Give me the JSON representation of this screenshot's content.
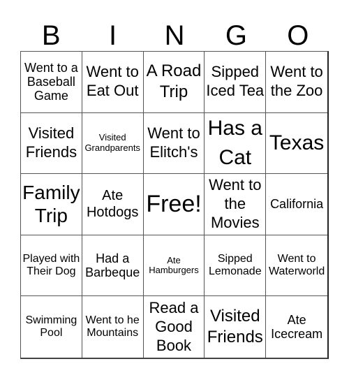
{
  "header": [
    "B",
    "I",
    "N",
    "G",
    "O"
  ],
  "cells": [
    "Went to a Baseball Game",
    "Went to Eat Out",
    "A Road Trip",
    "Sipped Iced Tea",
    "Went to the Zoo",
    "Visited Friends",
    "Visited Grandparents",
    "Went to Elitch's",
    "Has a Cat",
    "Texas",
    "Family Trip",
    "Ate Hotdogs",
    "Free!",
    "Went to the Movies",
    "California",
    "Played with Their Dog",
    "Had a Barbeque",
    "Ate Hamburgers",
    "Sipped Lemonade",
    "Went to Waterworld",
    "Swimming Pool",
    "Went to he Mountains",
    "Read a Good Book",
    "Visited Friends",
    "Ate Icecream"
  ]
}
